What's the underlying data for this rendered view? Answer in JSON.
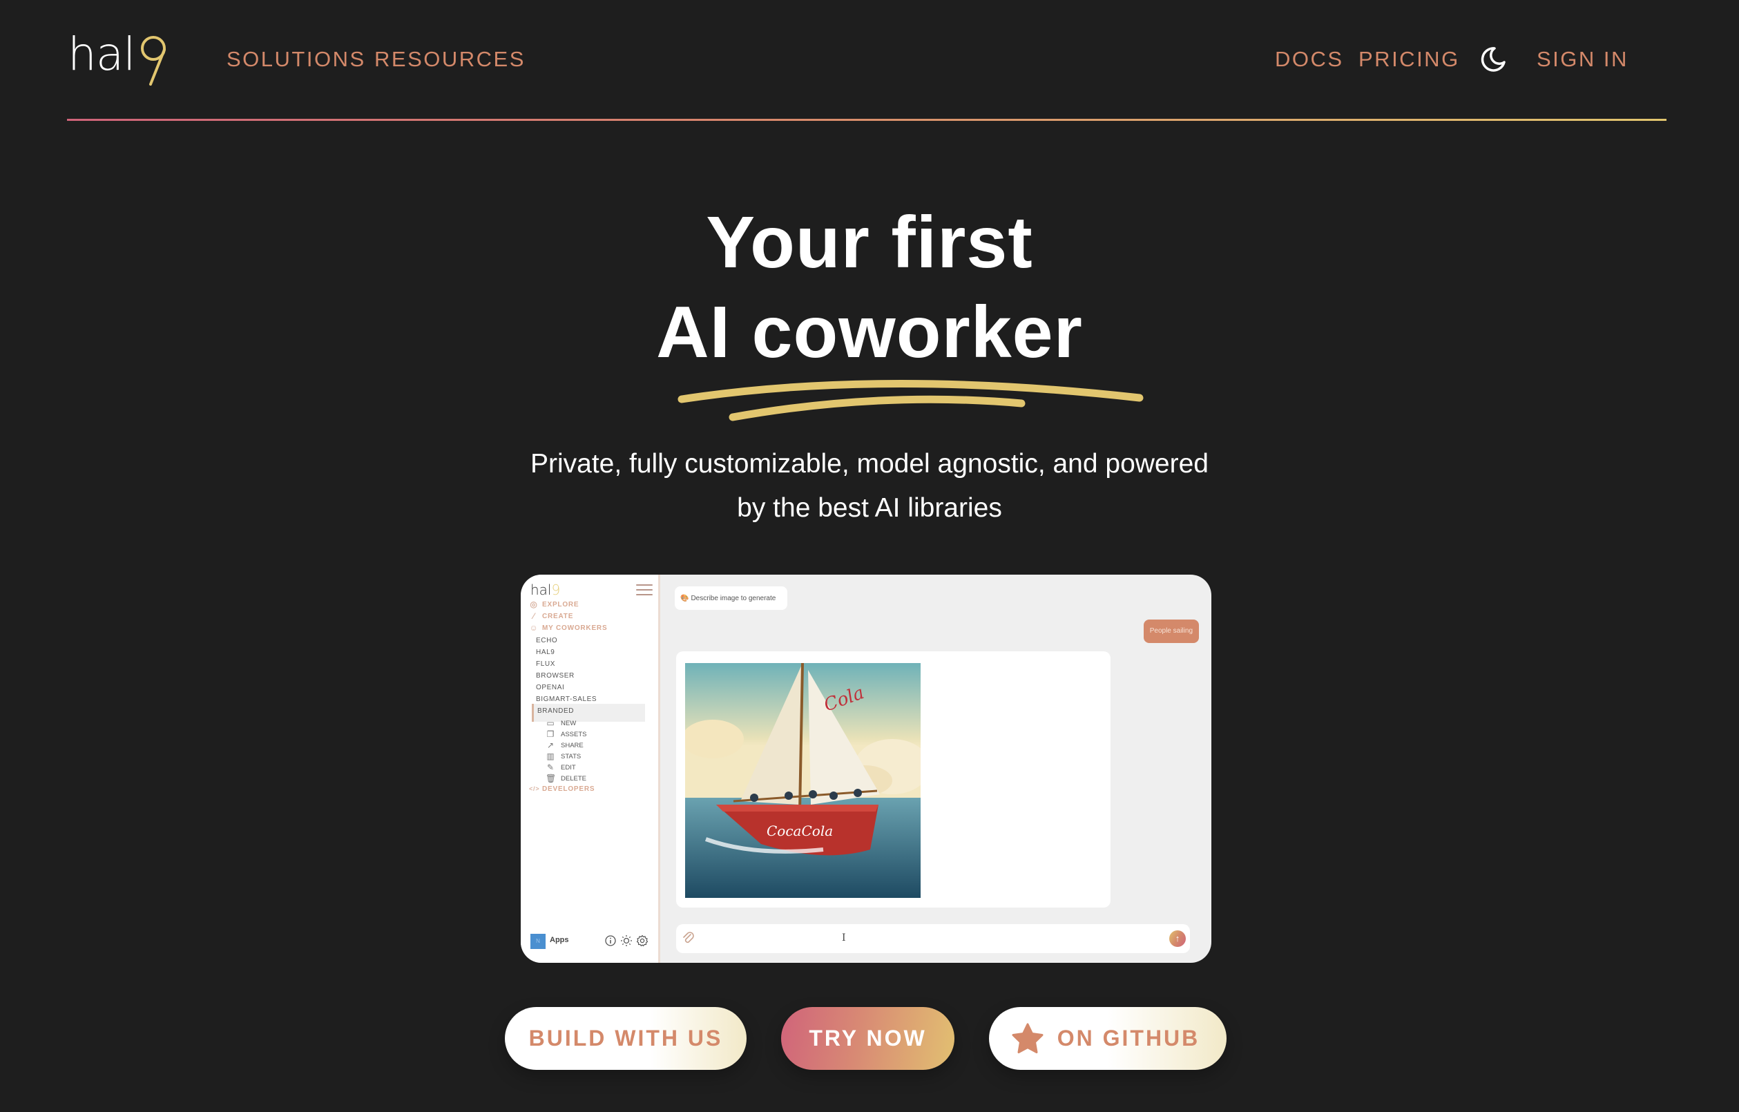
{
  "header": {
    "logo": {
      "text": "hal",
      "accent_text": "9"
    },
    "nav_left": [
      {
        "label": "SOLUTIONS"
      },
      {
        "label": "RESOURCES"
      }
    ],
    "nav_right": [
      {
        "label": "DOCS"
      },
      {
        "label": "PRICING"
      }
    ],
    "theme_toggle_icon": "moon-icon",
    "sign_in_label": "SIGN IN"
  },
  "hero": {
    "title_line1": "Your first",
    "title_line2": "AI coworker",
    "subtitle_line1": "Private, fully customizable, model agnostic, and powered",
    "subtitle_line2": "by the best AI libraries"
  },
  "app_preview": {
    "logo": {
      "text": "hal",
      "accent_text": "9"
    },
    "nav": [
      {
        "label": "EXPLORE",
        "icon": "compass-icon"
      },
      {
        "label": "CREATE",
        "icon": "magic-wand-icon"
      },
      {
        "label": "MY COWORKERS",
        "icon": "robot-icon"
      }
    ],
    "coworkers": [
      "ECHO",
      "HAL9",
      "FLUX",
      "BROWSER",
      "OPENAI",
      "BIGMART-SALES",
      "BRANDED"
    ],
    "selected_coworker": "BRANDED",
    "coworker_actions": [
      {
        "label": "NEW",
        "icon": "chat-bubbles-icon"
      },
      {
        "label": "ASSETS",
        "icon": "copy-icon"
      },
      {
        "label": "SHARE",
        "icon": "share-icon"
      },
      {
        "label": "STATS",
        "icon": "bar-chart-icon"
      },
      {
        "label": "EDIT",
        "icon": "edit-icon"
      },
      {
        "label": "DELETE",
        "icon": "trash-icon"
      }
    ],
    "developers_label": "DEVELOPERS",
    "footer": {
      "avatar_initial": "N",
      "workspace_label": "Apps",
      "icons": [
        "info-icon",
        "sun-icon",
        "gear-icon"
      ]
    },
    "prompt_chip": "Describe image to generate",
    "user_message": "People sailing",
    "generated_image_alt": "Red Coca-Cola branded sailboat with people sailing on the ocean",
    "input_placeholder": ""
  },
  "cta": {
    "build_label": "BUILD WITH US",
    "try_label": "TRY NOW",
    "github_label": "ON GITHUB"
  },
  "colors": {
    "background": "#1e1e1e",
    "accent": "#d4896a",
    "gold": "#e2c66f",
    "pink": "#d0647a"
  }
}
